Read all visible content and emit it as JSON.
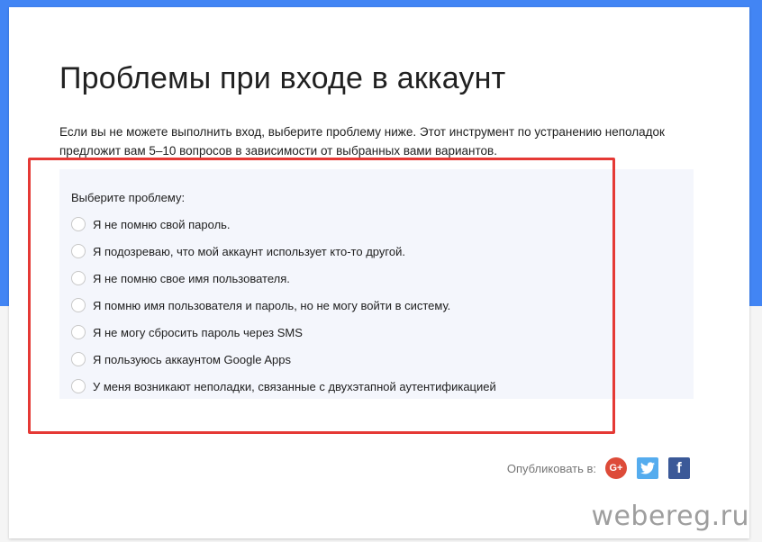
{
  "page": {
    "title": "Проблемы при входе в аккаунт",
    "description": "Если вы не можете выполнить вход, выберите проблему ниже. Этот инструмент по устранению неполадок предложит вам 5–10 вопросов в зависимости от выбранных вами вариантов."
  },
  "options": {
    "label": "Выберите проблему:",
    "items": [
      "Я не помню свой пароль.",
      "Я подозреваю, что мой аккаунт использует кто-то другой.",
      "Я не помню свое имя пользователя.",
      "Я помню имя пользователя и пароль, но не могу войти в систему.",
      "Я не могу сбросить пароль через SMS",
      "Я пользуюсь аккаунтом Google Apps",
      "У меня возникают неполадки, связанные с двухэтапной аутентификацией"
    ]
  },
  "share": {
    "label": "Опубликовать в:",
    "gplus_glyph": "G+",
    "facebook_glyph": "f",
    "icons": [
      "google-plus-icon",
      "twitter-icon",
      "facebook-icon"
    ]
  },
  "watermark": "webereg.ru",
  "colors": {
    "accent_blue": "#4285f4",
    "highlight_red": "#e53935",
    "panel_bg": "#f4f6fc"
  }
}
